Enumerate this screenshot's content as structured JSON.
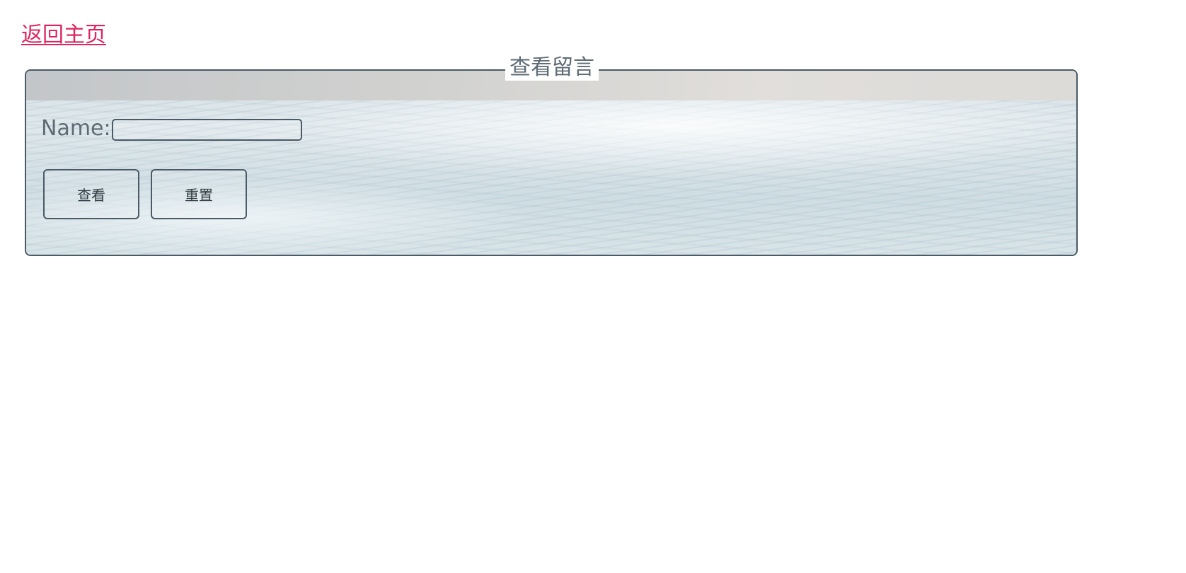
{
  "nav": {
    "home_link": "返回主页"
  },
  "form": {
    "legend": "查看留言",
    "name_label": "Name:",
    "name_value": "",
    "view_button": "查看",
    "reset_button": "重置"
  },
  "colors": {
    "link": "#e0245e",
    "text": "#5e6b74",
    "border": "#4a5a66"
  }
}
